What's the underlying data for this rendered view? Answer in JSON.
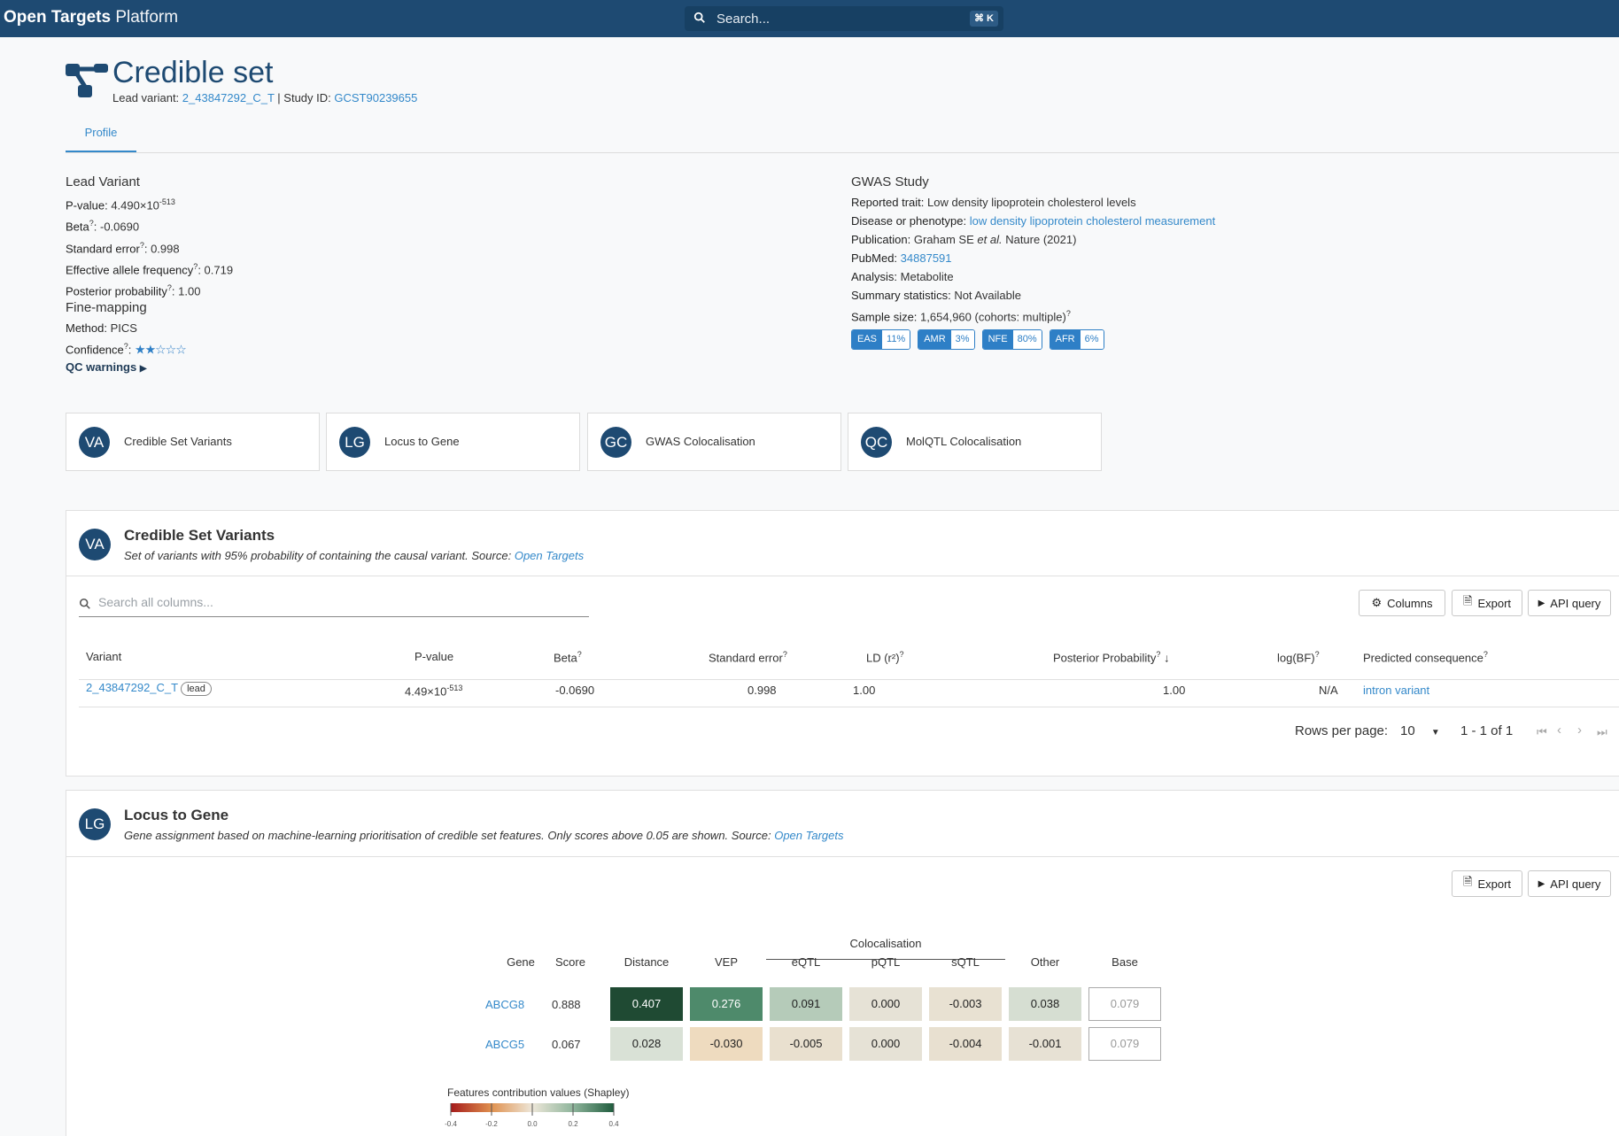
{
  "topbar": {
    "brand_bold": "Open Targets",
    "brand_light": " Platform",
    "search_placeholder": "Search...",
    "search_shortcut": "⌘ K"
  },
  "header": {
    "title": "Credible set",
    "lead_variant_label": "Lead variant:",
    "lead_variant": "2_43847292_C_T",
    "separator": "|",
    "study_id_label": "Study ID:",
    "study_id": "GCST90239655",
    "tab": "Profile"
  },
  "lead_variant": {
    "heading": "Lead Variant",
    "pvalue_label": "P-value:",
    "pvalue_mant": "4.490×10",
    "pvalue_exp": "-513",
    "beta_label": "Beta",
    "beta": "-0.0690",
    "se_label": "Standard error",
    "se": "0.998",
    "eaf_label": "Effective allele frequency",
    "eaf": "0.719",
    "pp_label": "Posterior probability",
    "pp": "1.00",
    "tooltip_mark": "?"
  },
  "fine_mapping": {
    "heading": "Fine-mapping",
    "method_label": "Method:",
    "method": "PICS",
    "confidence_label": "Confidence",
    "confidence_stars_filled": 2,
    "confidence_stars_total": 5,
    "qc_warnings": "QC warnings"
  },
  "gwas_study": {
    "heading": "GWAS Study",
    "trait_label": "Reported trait:",
    "trait": "Low density lipoprotein cholesterol levels",
    "disease_label": "Disease or phenotype:",
    "disease": "low density lipoprotein cholesterol measurement",
    "publication_label": "Publication:",
    "publication_author": "Graham SE",
    "publication_etal": "et al.",
    "publication_rest": "Nature (2021)",
    "pubmed_label": "PubMed:",
    "pubmed": "34887591",
    "analysis_label": "Analysis:",
    "analysis": "Metabolite",
    "sumstats_label": "Summary statistics:",
    "sumstats": "Not Available",
    "sample_label": "Sample size:",
    "sample": "1,654,960 (cohorts: multiple)",
    "ancestries": [
      {
        "name": "EAS",
        "pct": "11%"
      },
      {
        "name": "AMR",
        "pct": "3%"
      },
      {
        "name": "NFE",
        "pct": "80%"
      },
      {
        "name": "AFR",
        "pct": "6%"
      }
    ]
  },
  "section_cards": [
    {
      "abbr": "VA",
      "label": "Credible Set Variants"
    },
    {
      "abbr": "LG",
      "label": "Locus to Gene"
    },
    {
      "abbr": "GC",
      "label": "GWAS Colocalisation"
    },
    {
      "abbr": "QC",
      "label": "MolQTL Colocalisation"
    }
  ],
  "csv_widget": {
    "abbr": "VA",
    "title": "Credible Set Variants",
    "desc": "Set of variants with 95% probability of containing the causal variant. Source:",
    "source": "Open Targets",
    "search_placeholder": "Search all columns...",
    "btn_columns": "Columns",
    "btn_export": "Export",
    "btn_api": "API query",
    "columns": [
      "Variant",
      "P-value",
      "Beta",
      "Standard error",
      "LD (r²)",
      "Posterior Probability",
      "log(BF)",
      "Predicted consequence"
    ],
    "row": {
      "variant": "2_43847292_C_T",
      "chip": "lead",
      "pvalue_mant": "4.49×10",
      "pvalue_exp": "-513",
      "beta": "-0.0690",
      "se": "0.998",
      "ld": "1.00",
      "pp": "1.00",
      "logbf": "N/A",
      "consequence": "intron variant"
    },
    "rows_per_page_label": "Rows per page:",
    "rows_per_page": "10",
    "page_range": "1 - 1 of 1"
  },
  "l2g_widget": {
    "abbr": "LG",
    "title": "Locus to Gene",
    "desc": "Gene assignment based on machine-learning prioritisation of credible set features. Only scores above 0.05 are shown. Source:",
    "source": "Open Targets",
    "btn_export": "Export",
    "btn_api": "API query",
    "group_header": "Colocalisation",
    "columns": [
      "Gene",
      "Score",
      "Distance",
      "VEP",
      "eQTL",
      "pQTL",
      "sQTL",
      "Other",
      "Base"
    ],
    "rows": [
      {
        "gene": "ABCG8",
        "score": "0.888",
        "cells": [
          {
            "v": "0.407",
            "bg": "#1f4a33",
            "fg": "#ffffff"
          },
          {
            "v": "0.276",
            "bg": "#4e8a6b",
            "fg": "#ffffff"
          },
          {
            "v": "0.091",
            "bg": "#b5cbb9",
            "fg": "#222222"
          },
          {
            "v": "0.000",
            "bg": "#e6e2d6",
            "fg": "#222222"
          },
          {
            "v": "-0.003",
            "bg": "#e8e1d2",
            "fg": "#222222"
          },
          {
            "v": "0.038",
            "bg": "#d6ded2",
            "fg": "#222222"
          }
        ],
        "base": "0.079"
      },
      {
        "gene": "ABCG5",
        "score": "0.067",
        "cells": [
          {
            "v": "0.028",
            "bg": "#d9e1d6",
            "fg": "#222222"
          },
          {
            "v": "-0.030",
            "bg": "#eedbbf",
            "fg": "#222222"
          },
          {
            "v": "-0.005",
            "bg": "#e9e0cf",
            "fg": "#222222"
          },
          {
            "v": "0.000",
            "bg": "#e6e2d6",
            "fg": "#222222"
          },
          {
            "v": "-0.004",
            "bg": "#e8e0d0",
            "fg": "#222222"
          },
          {
            "v": "-0.001",
            "bg": "#e7e1d4",
            "fg": "#222222"
          }
        ],
        "base": "0.079"
      }
    ],
    "legend_title": "Features contribution values (Shapley)",
    "legend_ticks": [
      "-0.4",
      "-0.2",
      "0.0",
      "0.2",
      "0.4"
    ]
  }
}
